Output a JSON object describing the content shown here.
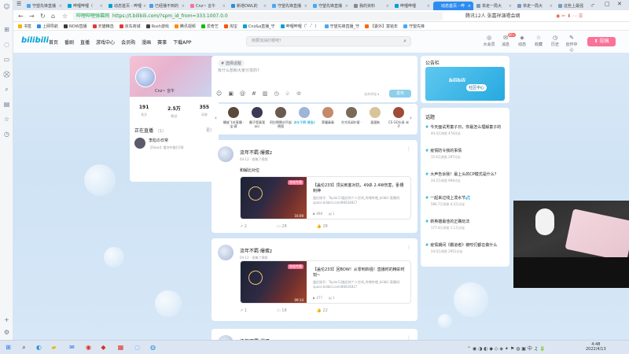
{
  "colors": {
    "accent": "#00a1d6",
    "pink": "#fb7299",
    "tab_active": "#2d8cf0"
  },
  "tabs": [
    {
      "label": "守望先锋直播",
      "color": "#4aa8f0"
    },
    {
      "label": "哔哩哔哩（",
      "color": "#00a1d6"
    },
    {
      "label": "动态首页 - 哔哩",
      "color": "#00a1d6"
    },
    {
      "label": "已经播不到的",
      "color": "#4c9be8"
    },
    {
      "label": "Cnz~ 言午",
      "color": "#fb7299"
    },
    {
      "label": "新增OWL的",
      "color": "#2f8ee0"
    },
    {
      "label": "守望先锋直播",
      "color": "#4aa8f0"
    },
    {
      "label": "守望先锋直播",
      "color": "#4aa8f0"
    },
    {
      "label": "我的资料",
      "color": "#888"
    },
    {
      "label": "哔哩哔哩",
      "color": "#00a1d6"
    },
    {
      "label": "动态首页 - 哔",
      "color": "#2d8cf0",
      "active": true
    },
    {
      "label": "单走一局大",
      "color": "#7a9abf"
    },
    {
      "label": "单走一局大",
      "color": "#7a9abf"
    },
    {
      "label": "这些上最强",
      "color": "#7a9abf"
    }
  ],
  "address": {
    "secure_label": "哔哩哔哩弹幕网",
    "url": "https://t.bilibili.com/?spm_id_from=333.1007.0.0",
    "right_text": "腾讯12人 张嘉祥演唱会纲"
  },
  "bookmarks": [
    {
      "label": "书签",
      "color": "#f5b400"
    },
    {
      "label": "上网导航",
      "color": "#2d8cf0"
    },
    {
      "label": "NOW直播",
      "color": "#3a3a3a"
    },
    {
      "label": "天猫精选",
      "color": "#e4393c"
    },
    {
      "label": "京东商城",
      "color": "#e4393c"
    },
    {
      "label": "Rush游戏",
      "color": "#444"
    },
    {
      "label": "腾讯视频",
      "color": "#ff8a00"
    },
    {
      "label": "爱奇艺",
      "color": "#00be06"
    },
    {
      "label": "淘宝",
      "color": "#ff5000"
    },
    {
      "label": "Cnz&a直播_守",
      "color": "#00a1d6"
    },
    {
      "label": "哔哩哔哩（゜-゜）",
      "color": "#00a1d6"
    },
    {
      "label": "守望先锋直播_守",
      "color": "#4aa8f0"
    },
    {
      "label": "【委外】富铭年",
      "color": "#ff6600"
    },
    {
      "label": "守望先锋",
      "color": "#4aa8f0"
    }
  ],
  "header": {
    "logo": "bilibili",
    "nav": [
      "首页",
      "番剧",
      "直播",
      "游戏中心",
      "会员购",
      "漫画",
      "赛事",
      "下载APP"
    ],
    "search_placeholder": "她要加油打眼吧？",
    "icons": [
      {
        "label": "大会员",
        "glyph": "◎"
      },
      {
        "label": "消息",
        "glyph": "✉",
        "badge": "99+"
      },
      {
        "label": "动态",
        "glyph": "◈"
      },
      {
        "label": "收藏",
        "glyph": "☆"
      },
      {
        "label": "历史",
        "glyph": "◷"
      },
      {
        "label": "创作中心",
        "glyph": "✎"
      }
    ],
    "upload": "投稿"
  },
  "profile": {
    "name": "Cnz~ 言午",
    "stats": [
      {
        "num": "191",
        "label": "关注"
      },
      {
        "num": "2.5万",
        "label": "粉丝"
      },
      {
        "num": "355",
        "label": "动态"
      }
    ]
  },
  "live": {
    "title": "正在直播",
    "count": "(1)",
    "more": "更多",
    "item_name": "李彪の日常",
    "item_desc": "【Faker】看你中路打OB"
  },
  "composer": {
    "tag": "# 选择话题",
    "placeholder": "有什么想和大家分享的?",
    "visibility": "允许评论 ▾",
    "send": "发布"
  },
  "following": [
    {
      "name": "播放飞羊直播 ·宝·赛",
      "color": "#5a4a3a"
    },
    {
      "name": "圈子是真我 acc",
      "color": "#3b3b55"
    },
    {
      "name": "阿拉啊啊对不起 德国",
      "color": "#6a5a4f"
    },
    {
      "name": "流年不羁·爆蛋z",
      "color": "#9fb4d8",
      "sel": true
    },
    {
      "name": "荣耀鼻鼻",
      "color": "#c48a6a"
    },
    {
      "name": "冷冷风阔尔星 ·",
      "color": "#7a6a5a"
    },
    {
      "name": "溜溜狗",
      "color": "#d8c49a"
    },
    {
      "name": "CS GO头条 米子",
      "color": "#a04a3a"
    }
  ],
  "posts": [
    {
      "name": "流年不羁·爆蛋z",
      "meta": "04-12 · 投稿了视频",
      "text": "和解比对位",
      "title": "【盖伦233】顶尖刺客对抗，49杀 2.4W伤害，卧槽 刺神",
      "desc": "盖伦账号：Taylor13盖伦的个人空间_哔哩哔哩_bilibili 直播间：space.bilibili.com/86634817",
      "views": "898",
      "danmaku": "1",
      "badge": "充电专属",
      "duration": "16:09",
      "likes": "2",
      "comments": "28",
      "shares": "28"
    },
    {
      "name": "流年不羁·爆蛋z",
      "meta": "04-12 · 投稿了视频",
      "text": "",
      "title": "【盖伦233】回BOW！从零到四强！直播时的精彩时刻~",
      "desc": "盖伦账号：Taylor13盖伦的个人空间_哔哩哔哩_bilibili 直播间：space.bilibili.com/86634817",
      "views": "477",
      "danmaku": "1",
      "badge": "充电专属",
      "duration": "09:14",
      "likes": "1",
      "comments": "18",
      "shares": "22"
    },
    {
      "name": "流年不羁·爆蛋z",
      "meta": "",
      "text": "",
      "title": "",
      "desc": "",
      "views": "",
      "danmaku": "",
      "badge": "",
      "duration": "",
      "likes": "",
      "comments": "",
      "shares": ""
    }
  ],
  "public_board": {
    "title": "公告栏",
    "banner_logo": "bilibili",
    "banner_text": "社区中心"
  },
  "topics": {
    "title": "话题",
    "items": [
      {
        "title": "今天面试男童子日，你最怎么理解童子的",
        "meta": "44.4万浏览 474讨论"
      },
      {
        "title": "疫情防令我的事情",
        "meta": "15.6万浏览 297讨论"
      },
      {
        "title": "大声告诉我！最上头的CP模式是什么？",
        "meta": "24.2万浏览 994讨论"
      },
      {
        "title": "一起来过线上泼水节💦",
        "meta": "586.7万浏览 4.3万讨论"
      },
      {
        "title": "新英雄最佳的正确玩法",
        "meta": "177.4万浏览 1.1万讨论"
      },
      {
        "title": "疫情期间《霸道者》被咬们都在做什么",
        "meta": "24.0万浏览 2951讨论"
      }
    ]
  },
  "taskbar": {
    "time": "4:48",
    "date": "2022/4/13"
  }
}
